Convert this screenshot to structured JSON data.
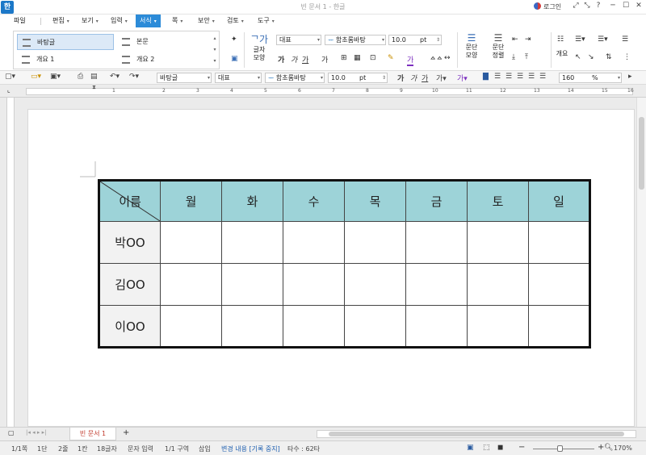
{
  "titlebar": {
    "app_icon": "한",
    "title": "빈 문서 1 - 한글",
    "login": "로그인"
  },
  "menu": {
    "items": [
      "파일",
      "편집",
      "보기",
      "입력",
      "서식",
      "쪽",
      "보안",
      "검토",
      "도구"
    ],
    "active": "서식"
  },
  "ribbon": {
    "styles": [
      "바탕글",
      "본문",
      "개요 1",
      "개요 2"
    ],
    "char_shape_label": "글자\n모양",
    "para_shape_label": "문단\n모양",
    "para_align_label": "문단\n정렬",
    "outline_label": "개요",
    "style_combo": "대표",
    "font_combo": "함초롬바탕",
    "size_value": "10.0",
    "size_unit": "pt"
  },
  "toolbar": {
    "style_combo": "바탕글",
    "lang_combo": "대표",
    "font_combo": "함초롬바탕",
    "size_value": "10.0",
    "size_unit": "pt",
    "zoom_value": "160",
    "zoom_unit": "%"
  },
  "ruler": {
    "numbers": [
      "1",
      "2",
      "3",
      "4",
      "5",
      "6",
      "7",
      "8",
      "9",
      "10",
      "11",
      "12",
      "13",
      "14",
      "15",
      "16"
    ]
  },
  "table": {
    "corner_label": "이름",
    "days": [
      "월",
      "화",
      "수",
      "목",
      "금",
      "토",
      "일"
    ],
    "names": [
      "박OO",
      "김OO",
      "이OO"
    ]
  },
  "tabs": {
    "doc_tab": "빈 문서 1",
    "add_tab": "+"
  },
  "status": {
    "page": "1/1쪽",
    "section": "1단",
    "line": "2줄",
    "column": "1칸",
    "chars": "18글자",
    "input_mode": "문자 입력",
    "area": "1/1 구역",
    "insert_mode": "삽입",
    "track_changes": "변경 내용 [기록 중지]",
    "keystrokes": "타수 : 62타",
    "zoom": "170%"
  }
}
